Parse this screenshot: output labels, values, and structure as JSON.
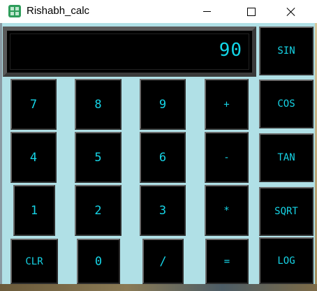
{
  "window": {
    "title": "Rishabh_calc",
    "controls": {
      "minimize": "minimize",
      "maximize": "maximize",
      "close": "close"
    }
  },
  "display": {
    "value": "90"
  },
  "keys": {
    "k7": "7",
    "k8": "8",
    "k9": "9",
    "plus": "+",
    "k4": "4",
    "k5": "5",
    "k6": "6",
    "minus": "-",
    "k1": "1",
    "k2": "2",
    "k3": "3",
    "multiply": "*",
    "clr": "CLR",
    "k0": "0",
    "divide": "/",
    "equals": "="
  },
  "functions": {
    "sin": "SIN",
    "cos": "COS",
    "tan": "TAN",
    "sqrt": "SQRT",
    "log": "LOG"
  },
  "colors": {
    "background": "#b0e0e6",
    "key_face": "#000000",
    "key_text": "#16d4e6"
  }
}
